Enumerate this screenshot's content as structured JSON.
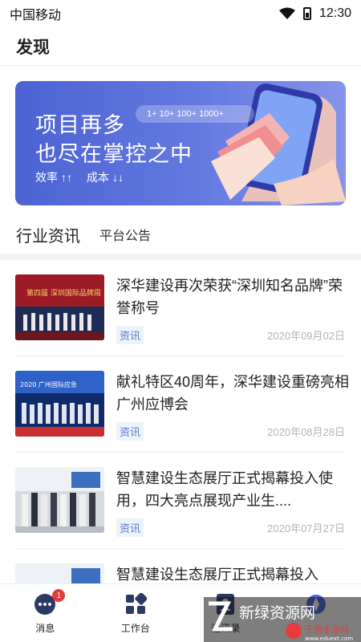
{
  "statusbar": {
    "carrier": "中国移动",
    "time": "12:30"
  },
  "header": {
    "title": "发现"
  },
  "banner": {
    "line1": "项目再多",
    "line2": "也尽在掌控之中",
    "pill": "1+  10+  100+  1000+",
    "tag1": "效率",
    "tag2": "成本"
  },
  "tabs": [
    {
      "label": "行业资讯",
      "active": true
    },
    {
      "label": "平台公告",
      "active": false
    }
  ],
  "news": [
    {
      "title": "深华建设再次荣获“深圳知名品牌”荣誉称号",
      "tag": "资讯",
      "date": "2020年09月02日"
    },
    {
      "title": "献礼特区40周年，深华建设重磅亮相广州应博会",
      "tag": "资讯",
      "date": "2020年08月28日"
    },
    {
      "title": "智慧建设生态展厅正式揭幕投入使用，四大亮点展现产业生....",
      "tag": "资讯",
      "date": "2020年07月27日"
    },
    {
      "title": "智慧建设生态展厅正式揭幕投入",
      "tag": "",
      "date": ""
    }
  ],
  "bottomnav": [
    {
      "label": "消息",
      "icon": "chat-icon",
      "badge": "1"
    },
    {
      "label": "工作台",
      "icon": "grid-icon",
      "badge": ""
    },
    {
      "label": "通讯录",
      "icon": "contacts-icon",
      "badge": ""
    },
    {
      "label": "",
      "icon": "discover-icon",
      "badge": ""
    }
  ],
  "watermark": {
    "text": "新绿资源网",
    "sub": "干货手游网",
    "url": "www.eduext.com"
  },
  "colors": {
    "accent": "#4b63d3",
    "badge": "#e63b3b",
    "tag_text": "#5a78c8"
  }
}
